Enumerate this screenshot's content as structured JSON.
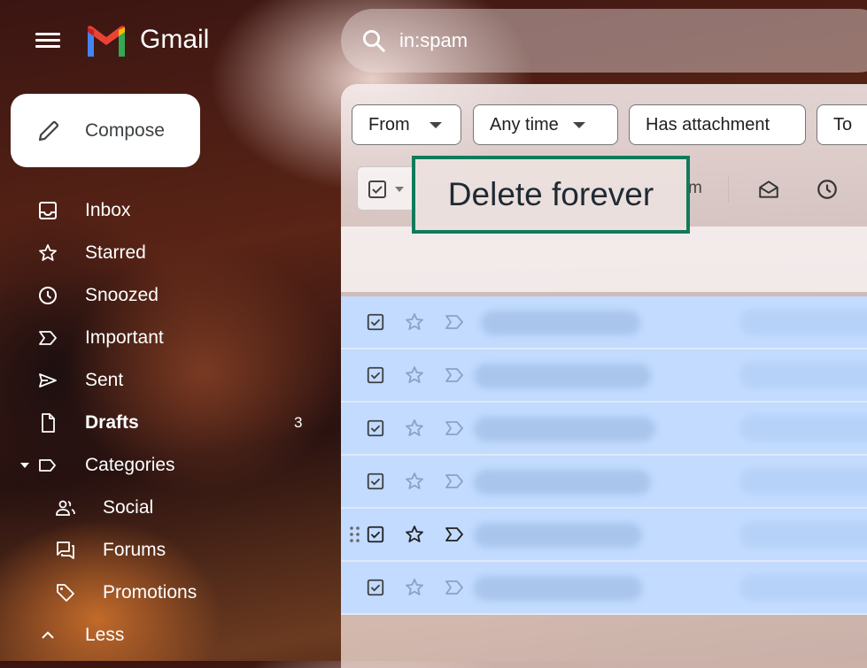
{
  "app": {
    "brand": "Gmail",
    "search_query": "in:spam"
  },
  "compose": {
    "label": "Compose"
  },
  "nav": {
    "items": [
      {
        "label": "Inbox",
        "icon": "inbox-icon"
      },
      {
        "label": "Starred",
        "icon": "star-icon"
      },
      {
        "label": "Snoozed",
        "icon": "clock-icon"
      },
      {
        "label": "Important",
        "icon": "important-icon"
      },
      {
        "label": "Sent",
        "icon": "send-icon"
      },
      {
        "label": "Drafts",
        "icon": "file-icon",
        "count": "3"
      },
      {
        "label": "Categories",
        "icon": "label-icon"
      },
      {
        "label": "Social",
        "icon": "people-icon"
      },
      {
        "label": "Forums",
        "icon": "forum-icon"
      },
      {
        "label": "Promotions",
        "icon": "tag-icon"
      },
      {
        "label": "Less",
        "icon": "chevron-up-icon"
      }
    ]
  },
  "filters": {
    "from": "From",
    "any_time": "Any time",
    "has_attachment": "Has attachment",
    "to": "To"
  },
  "toolbar": {
    "partial_label": "m",
    "tooltip": "Delete forever"
  },
  "colors": {
    "selected_row": "#c2dbff",
    "tooltip_border": "#127a5a"
  }
}
